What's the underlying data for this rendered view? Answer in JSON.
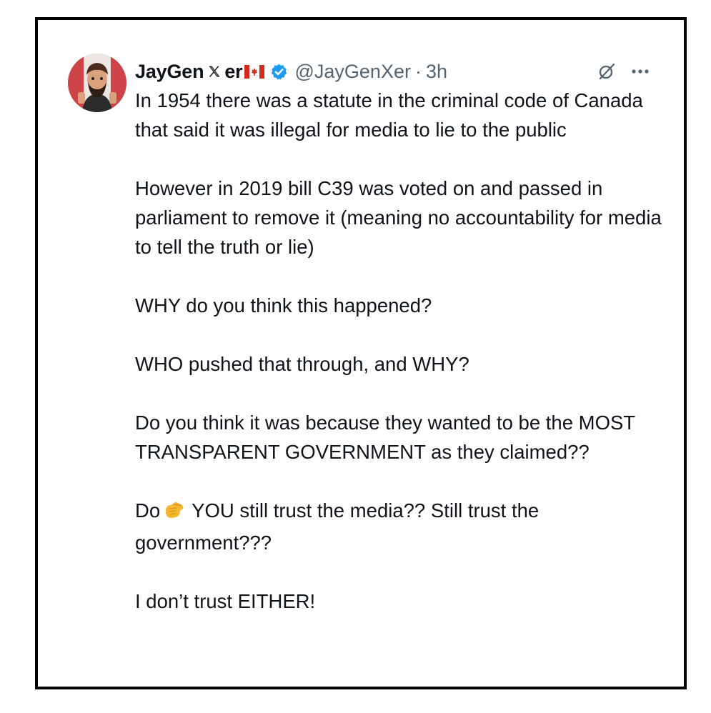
{
  "tweet": {
    "display_name_part1": "JayGen",
    "display_name_part2": "er",
    "verified": true,
    "handle": "@JayGenXer",
    "separator": "·",
    "time": "3h",
    "icons": {
      "avatar": "avatar",
      "x_logo": "x-logo-icon",
      "flag": "canada-flag-icon",
      "badge": "verified-badge-icon",
      "grok": "grok-icon",
      "more": "more-options-icon",
      "emoji": "pointing-hand-emoji"
    },
    "paragraphs": {
      "p1": "In 1954 there was a statute in the criminal code of Canada that said it was illegal for media to lie to the public",
      "p2": "However in 2019 bill C39 was voted on and passed in parliament to remove it (meaning no accountability for media to tell the truth or lie)",
      "p3": "WHY do you think this happened?",
      "p4": "WHO pushed that through, and WHY?",
      "p5": "Do you think it was because they wanted to be the MOST TRANSPARENT GOVERNMENT as they claimed??",
      "p6_start": "Do",
      "p6_end": "YOU still trust the media??  Still trust the government???",
      "p7": "I don’t trust EITHER!"
    },
    "colors": {
      "text": "#0f1419",
      "secondary": "#536471",
      "verified": "#1d9bf0",
      "flag_red": "#d52b1e",
      "frame": "#000000"
    }
  }
}
